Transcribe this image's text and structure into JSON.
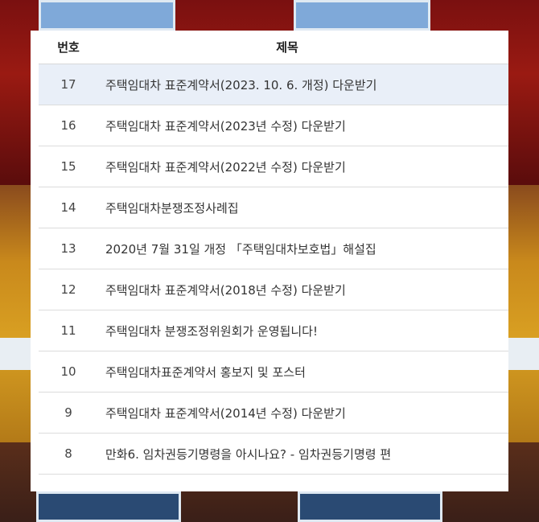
{
  "table": {
    "headers": {
      "num": "번호",
      "title": "제목"
    },
    "rows": [
      {
        "num": "17",
        "title": "주택임대차 표준계약서(2023. 10. 6. 개정) 다운받기"
      },
      {
        "num": "16",
        "title": "주택임대차 표준계약서(2023년 수정) 다운받기"
      },
      {
        "num": "15",
        "title": "주택임대차 표준계약서(2022년 수정) 다운받기"
      },
      {
        "num": "14",
        "title": "주택임대차분쟁조정사례집"
      },
      {
        "num": "13",
        "title": "2020년 7월 31일 개정 「주택임대차보호법」해설집"
      },
      {
        "num": "12",
        "title": "주택임대차 표준계약서(2018년 수정) 다운받기"
      },
      {
        "num": "11",
        "title": "주택임대차 분쟁조정위원회가 운영됩니다!"
      },
      {
        "num": "10",
        "title": "주택임대차표준계약서 홍보지 및 포스터"
      },
      {
        "num": "9",
        "title": "주택임대차 표준계약서(2014년 수정) 다운받기"
      },
      {
        "num": "8",
        "title": "만화6. 임차권등기명령을 아시나요? - 임차권등기명령 편"
      }
    ]
  },
  "colors": {
    "highlight_row": "#e9eff8",
    "border": "#dcdcdc",
    "text": "#333333"
  }
}
